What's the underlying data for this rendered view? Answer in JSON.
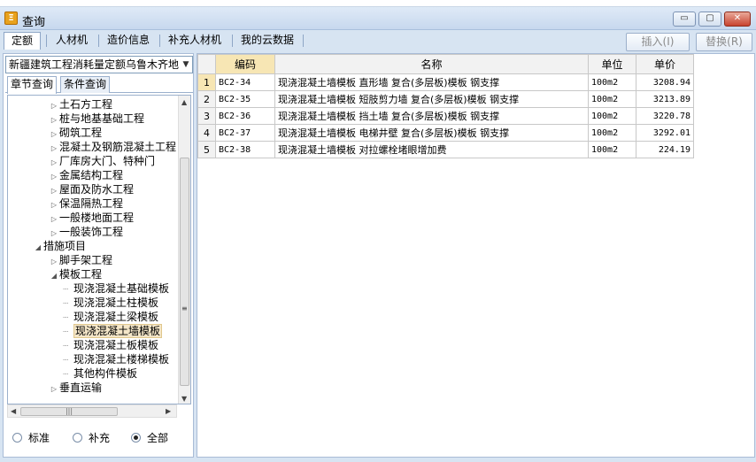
{
  "window": {
    "title": "查询",
    "icon": "query-app-icon",
    "controls": {
      "minimize": "▭",
      "maximize": "▢",
      "close": "✕"
    }
  },
  "tabs": [
    {
      "label": "定额",
      "active": true
    },
    {
      "label": "人材机",
      "active": false
    },
    {
      "label": "造价信息",
      "active": false
    },
    {
      "label": "补充人材机",
      "active": false
    },
    {
      "label": "我的云数据",
      "active": false
    }
  ],
  "actions": {
    "insert": "插入(I)",
    "replace": "替换(R)"
  },
  "left": {
    "quota_library": "新疆建筑工程消耗量定额乌鲁木齐地",
    "subtabs": [
      {
        "label": "章节查询",
        "active": true
      },
      {
        "label": "条件查询",
        "active": false
      }
    ],
    "tree": [
      {
        "label": "土石方工程",
        "level": 1,
        "expander": "▷"
      },
      {
        "label": "桩与地基基础工程",
        "level": 1,
        "expander": "▷"
      },
      {
        "label": "砌筑工程",
        "level": 1,
        "expander": "▷"
      },
      {
        "label": "混凝土及钢筋混凝土工程",
        "level": 1,
        "expander": "▷"
      },
      {
        "label": "厂库房大门、特种门",
        "level": 1,
        "expander": "▷"
      },
      {
        "label": "金属结构工程",
        "level": 1,
        "expander": "▷"
      },
      {
        "label": "屋面及防水工程",
        "level": 1,
        "expander": "▷"
      },
      {
        "label": "保温隔热工程",
        "level": 1,
        "expander": "▷"
      },
      {
        "label": "一般楼地面工程",
        "level": 1,
        "expander": "▷"
      },
      {
        "label": "一般装饰工程",
        "level": 1,
        "expander": "▷"
      },
      {
        "label": "措施项目",
        "level": 0,
        "expander": "◢"
      },
      {
        "label": "脚手架工程",
        "level": 1,
        "expander": "▷"
      },
      {
        "label": "模板工程",
        "level": 1,
        "expander": "◢"
      },
      {
        "label": "现浇混凝土基础模板",
        "level": 2,
        "expander": ""
      },
      {
        "label": "现浇混凝土柱模板",
        "level": 2,
        "expander": ""
      },
      {
        "label": "现浇混凝土梁模板",
        "level": 2,
        "expander": ""
      },
      {
        "label": "现浇混凝土墙模板",
        "level": 2,
        "expander": "",
        "selected": true
      },
      {
        "label": "现浇混凝土板模板",
        "level": 2,
        "expander": ""
      },
      {
        "label": "现浇混凝土楼梯模板",
        "level": 2,
        "expander": ""
      },
      {
        "label": "其他构件模板",
        "level": 2,
        "expander": ""
      },
      {
        "label": "垂直运输",
        "level": 1,
        "expander": "▷"
      }
    ],
    "radios": [
      {
        "label": "标准",
        "checked": false
      },
      {
        "label": "补充",
        "checked": false
      },
      {
        "label": "全部",
        "checked": true
      }
    ]
  },
  "grid": {
    "columns": [
      "",
      "编码",
      "名称",
      "单位",
      "单价"
    ],
    "rows": [
      {
        "index": "1",
        "code": "BC2-34",
        "name": "现浇混凝土墙模板 直形墙 复合(多层板)模板 钢支撑",
        "unit": "100m2",
        "price": "3208.94",
        "selected": true
      },
      {
        "index": "2",
        "code": "BC2-35",
        "name": "现浇混凝土墙模板 短肢剪力墙 复合(多层板)模板 钢支撑",
        "unit": "100m2",
        "price": "3213.89"
      },
      {
        "index": "3",
        "code": "BC2-36",
        "name": "现浇混凝土墙模板 挡土墙 复合(多层板)模板 钢支撑",
        "unit": "100m2",
        "price": "3220.78"
      },
      {
        "index": "4",
        "code": "BC2-37",
        "name": "现浇混凝土墙模板 电梯井壁 复合(多层板)模板 钢支撑",
        "unit": "100m2",
        "price": "3292.01"
      },
      {
        "index": "5",
        "code": "BC2-38",
        "name": "现浇混凝土墙模板 对拉螺栓堵眼增加费",
        "unit": "100m2",
        "price": "224.19"
      }
    ]
  },
  "colors": {
    "accent": "#f7e6b4",
    "frame": "#d7e4f2",
    "selection": "#f4e6c8"
  }
}
